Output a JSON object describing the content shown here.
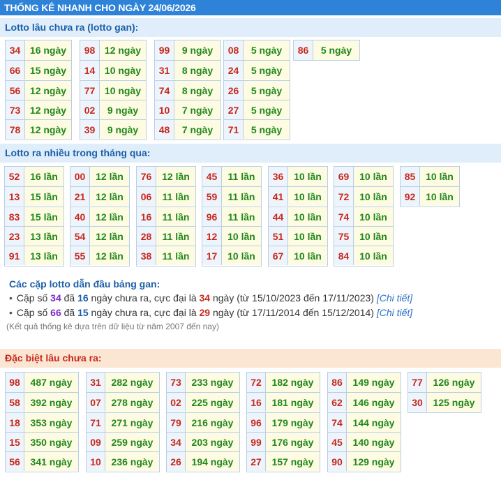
{
  "title": "THỐNG KÊ NHANH CHO NGÀY 24/06/2026",
  "colors": {
    "title_bg": "#2e83d8",
    "header_bg": "#dfeefa",
    "header_text": "#1d5fa8",
    "special_bg": "#fbe6d4",
    "special_text": "#c8281c",
    "number_text": "#c8281c",
    "value_text": "#20881b",
    "number_cell": "#edf4fb",
    "value_cell": "#fdfbe2"
  },
  "sections": {
    "gan": {
      "header": "Lotto lâu chưa ra (lotto gan):",
      "columns": [
        [
          [
            "34",
            "16 ngày"
          ],
          [
            "66",
            "15 ngày"
          ],
          [
            "56",
            "12 ngày"
          ],
          [
            "73",
            "12 ngày"
          ],
          [
            "78",
            "12 ngày"
          ]
        ],
        [
          [
            "98",
            "12 ngày"
          ],
          [
            "14",
            "10 ngày"
          ],
          [
            "77",
            "10 ngày"
          ],
          [
            "02",
            "9 ngày"
          ],
          [
            "39",
            "9 ngày"
          ]
        ],
        [
          [
            "99",
            "9 ngày"
          ],
          [
            "31",
            "8 ngày"
          ],
          [
            "74",
            "8 ngày"
          ],
          [
            "10",
            "7 ngày"
          ],
          [
            "48",
            "7 ngày"
          ]
        ],
        [
          [
            "08",
            "5 ngày"
          ],
          [
            "24",
            "5 ngày"
          ],
          [
            "26",
            "5 ngày"
          ],
          [
            "27",
            "5 ngày"
          ],
          [
            "71",
            "5 ngày"
          ]
        ],
        [
          [
            "86",
            "5 ngày"
          ]
        ]
      ]
    },
    "frequent": {
      "header": "Lotto ra nhiều trong tháng qua:",
      "columns": [
        [
          [
            "52",
            "16 lần"
          ],
          [
            "13",
            "15 lần"
          ],
          [
            "83",
            "15 lần"
          ],
          [
            "23",
            "13 lần"
          ],
          [
            "91",
            "13 lần"
          ]
        ],
        [
          [
            "00",
            "12 lần"
          ],
          [
            "21",
            "12 lần"
          ],
          [
            "40",
            "12 lần"
          ],
          [
            "54",
            "12 lần"
          ],
          [
            "55",
            "12 lần"
          ]
        ],
        [
          [
            "76",
            "12 lần"
          ],
          [
            "06",
            "11 lần"
          ],
          [
            "16",
            "11 lần"
          ],
          [
            "28",
            "11 lần"
          ],
          [
            "38",
            "11 lần"
          ]
        ],
        [
          [
            "45",
            "11 lần"
          ],
          [
            "59",
            "11 lần"
          ],
          [
            "96",
            "11 lần"
          ],
          [
            "12",
            "10 lần"
          ],
          [
            "17",
            "10 lần"
          ]
        ],
        [
          [
            "36",
            "10 lần"
          ],
          [
            "41",
            "10 lần"
          ],
          [
            "44",
            "10 lần"
          ],
          [
            "51",
            "10 lần"
          ],
          [
            "67",
            "10 lần"
          ]
        ],
        [
          [
            "69",
            "10 lần"
          ],
          [
            "72",
            "10 lần"
          ],
          [
            "74",
            "10 lần"
          ],
          [
            "75",
            "10 lần"
          ],
          [
            "84",
            "10 lần"
          ]
        ],
        [
          [
            "85",
            "10 lần"
          ],
          [
            "92",
            "10 lần"
          ]
        ]
      ]
    },
    "special": {
      "header": "Đặc biệt lâu chưa ra:",
      "columns": [
        [
          [
            "98",
            "487 ngày"
          ],
          [
            "58",
            "392 ngày"
          ],
          [
            "18",
            "353 ngày"
          ],
          [
            "15",
            "350 ngày"
          ],
          [
            "56",
            "341 ngày"
          ]
        ],
        [
          [
            "31",
            "282 ngày"
          ],
          [
            "07",
            "278 ngày"
          ],
          [
            "71",
            "271 ngày"
          ],
          [
            "09",
            "259 ngày"
          ],
          [
            "10",
            "236 ngày"
          ]
        ],
        [
          [
            "73",
            "233 ngày"
          ],
          [
            "02",
            "225 ngày"
          ],
          [
            "79",
            "216 ngày"
          ],
          [
            "34",
            "203 ngày"
          ],
          [
            "26",
            "194 ngày"
          ]
        ],
        [
          [
            "72",
            "182 ngày"
          ],
          [
            "16",
            "181 ngày"
          ],
          [
            "96",
            "179 ngày"
          ],
          [
            "99",
            "176 ngày"
          ],
          [
            "27",
            "157 ngày"
          ]
        ],
        [
          [
            "86",
            "149 ngày"
          ],
          [
            "62",
            "146 ngày"
          ],
          [
            "74",
            "144 ngày"
          ],
          [
            "45",
            "140 ngày"
          ],
          [
            "90",
            "129 ngày"
          ]
        ],
        [
          [
            "77",
            "126 ngày"
          ],
          [
            "30",
            "125 ngày"
          ]
        ]
      ]
    }
  },
  "pairs": {
    "title": "Các cặp lotto dẫn đầu bảng gan:",
    "lines": [
      {
        "bullet": "•",
        "a": "Cặp số ",
        "pair": "34",
        "b": " đã ",
        "days": "16",
        "c": " ngày chưa ra, cực đại là ",
        "max": "34",
        "d": " ngày (từ 15/10/2023 đến 17/11/2023) ",
        "link": "[Chi tiết]"
      },
      {
        "bullet": "•",
        "a": "Cặp số ",
        "pair": "66",
        "b": " đã ",
        "days": "15",
        "c": " ngày chưa ra, cực đại là ",
        "max": "29",
        "d": " ngày (từ 17/11/2014 đến 15/12/2014) ",
        "link": "[Chi tiết]"
      }
    ]
  },
  "note": "(Kết quả thống kê dựa trên dữ liệu từ năm 2007 đến nay)"
}
